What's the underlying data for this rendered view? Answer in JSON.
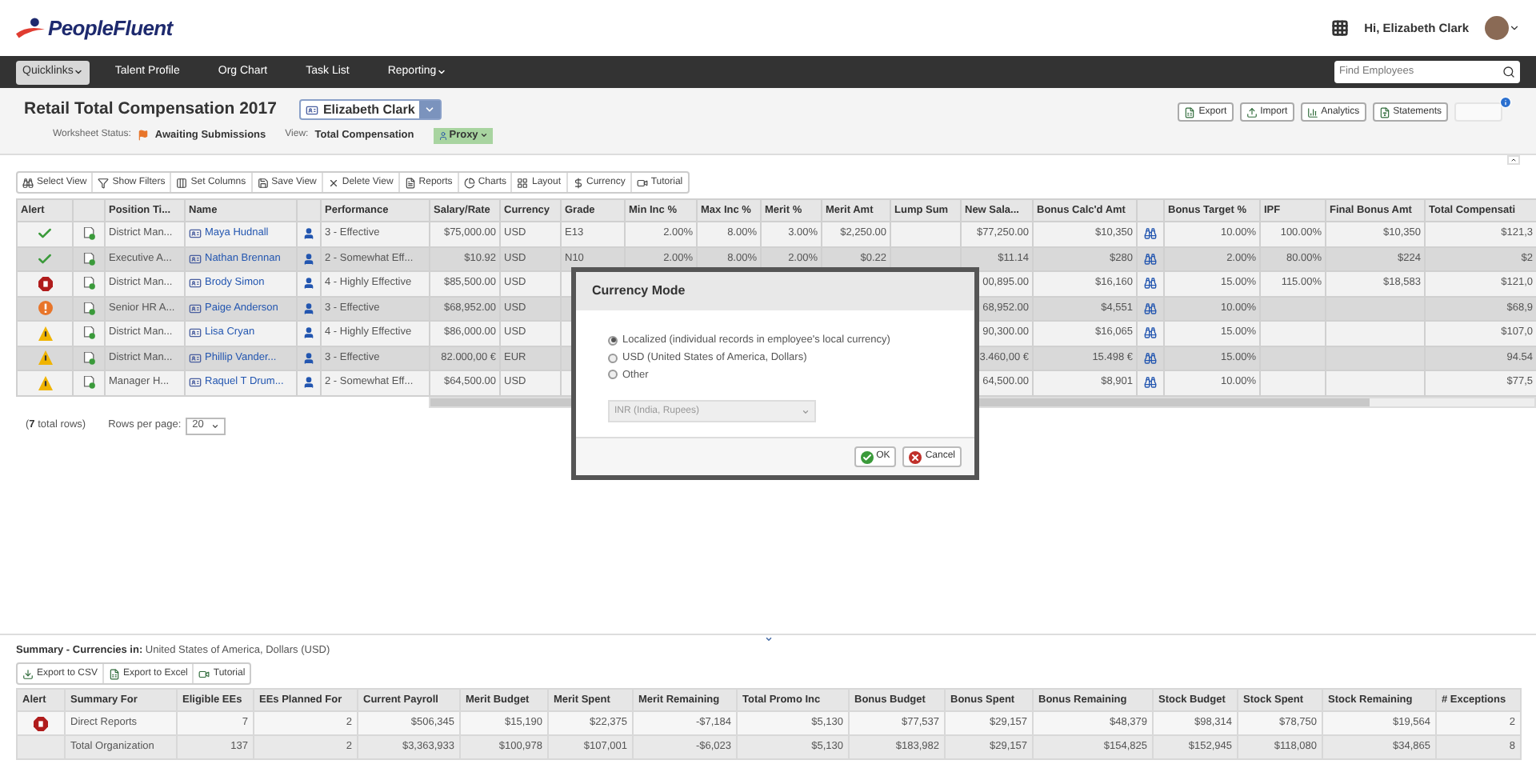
{
  "header": {
    "logo": "PeopleFluent",
    "greeting": "Hi, Elizabeth Clark"
  },
  "nav": {
    "items": [
      {
        "label": "Quicklinks",
        "kind": "button",
        "caret": true
      },
      {
        "label": "Talent Profile",
        "kind": "link",
        "caret": false
      },
      {
        "label": "Org Chart",
        "kind": "link",
        "caret": false
      },
      {
        "label": "Task List",
        "kind": "link",
        "caret": false
      },
      {
        "label": "Reporting",
        "kind": "link",
        "caret": true
      }
    ],
    "search": {
      "placeholder": "Find Employees"
    }
  },
  "worksheet": {
    "title": "Retail Total Compensation 2017",
    "employee": "Elizabeth Clark",
    "status_label": "Worksheet Status:",
    "status": "Awaiting Submissions",
    "view_label": "View:",
    "view": "Total Compensation",
    "proxy": "Proxy",
    "actions": [
      {
        "label": "Export",
        "disabled": false
      },
      {
        "label": "Import",
        "disabled": false
      },
      {
        "label": "Analytics",
        "disabled": false
      },
      {
        "label": "Statements",
        "disabled": false
      }
    ]
  },
  "toolbar": [
    "Select View",
    "Show Filters",
    "Set Columns",
    "Save View",
    "Delete View",
    "Reports",
    "Charts",
    "Layout",
    "Currency",
    "Tutorial"
  ],
  "table": {
    "columns": [
      {
        "kind": "text",
        "label": "Alert"
      },
      {
        "kind": "icon"
      },
      {
        "kind": "text",
        "label": "Position Ti..."
      },
      {
        "kind": "text",
        "label": "Name"
      },
      {
        "kind": "icon"
      },
      {
        "kind": "text",
        "label": "Performance"
      },
      {
        "kind": "text",
        "label": "Salary/Rate"
      },
      {
        "kind": "text",
        "label": "Currency"
      },
      {
        "kind": "text",
        "label": "Grade"
      },
      {
        "kind": "text",
        "label": "Min Inc %"
      },
      {
        "kind": "text",
        "label": "Max Inc %"
      },
      {
        "kind": "text",
        "label": "Merit %"
      },
      {
        "kind": "text",
        "label": "Merit Amt"
      },
      {
        "kind": "text",
        "label": "Lump Sum"
      },
      {
        "kind": "text",
        "label": "New Sala..."
      },
      {
        "kind": "text",
        "label": "Bonus Calc'd Amt"
      },
      {
        "kind": "icon"
      },
      {
        "kind": "text",
        "label": "Bonus Target %"
      },
      {
        "kind": "text",
        "label": "IPF"
      },
      {
        "kind": "text",
        "label": "Final Bonus Amt"
      },
      {
        "kind": "text",
        "label": "Total Compensati"
      }
    ],
    "rows": [
      {
        "alert": {
          "kind": "ok"
        },
        "position": "District Man...",
        "name": "Maya Hudnall",
        "performance": "3 - Effective",
        "salary": "$75,000.00",
        "currency": "USD",
        "grade": "E13",
        "min_inc": "2.00%",
        "max_inc": "8.00%",
        "merit_pct": "3.00%",
        "merit_amt": "$2,250.00",
        "new_salary": "$77,250.00",
        "bonus_calc": "$10,350",
        "bonus_target": "10.00%",
        "ipf": "100.00%",
        "final_bonus": "$10,350",
        "total_comp": "$121,3"
      },
      {
        "alert": {
          "kind": "ok"
        },
        "position": "Executive A...",
        "name": "Nathan Brennan",
        "performance": "2 - Somewhat Eff...",
        "salary": "$10.92",
        "currency": "USD",
        "grade": "N10",
        "min_inc": "2.00%",
        "max_inc": "8.00%",
        "merit_pct": "2.00%",
        "merit_amt": "$0.22",
        "new_salary": "$11.14",
        "bonus_calc": "$280",
        "bonus_target": "2.00%",
        "ipf": "80.00%",
        "final_bonus": "$224",
        "total_comp": "$2"
      },
      {
        "alert": {
          "kind": "stop"
        },
        "position": "District Man...",
        "name": "Brody Simon",
        "performance": "4 - Highly Effective",
        "salary": "$85,500.00",
        "currency": "USD",
        "new_salary": "00,895.00",
        "bonus_calc": "$16,160",
        "bonus_target": "15.00%",
        "ipf": "115.00%",
        "final_bonus": "$18,583",
        "total_comp": "$121,0"
      },
      {
        "alert": {
          "kind": "exclamation"
        },
        "position": "Senior HR A...",
        "name": "Paige Anderson",
        "performance": "3 - Effective",
        "salary": "$68,952.00",
        "currency": "USD",
        "new_salary": "68,952.00",
        "bonus_calc": "$4,551",
        "bonus_target": "10.00%",
        "total_comp": "$68,9"
      },
      {
        "alert": {
          "kind": "warning"
        },
        "position": "District Man...",
        "name": "Lisa Cryan",
        "performance": "4 - Highly Effective",
        "salary": "$86,000.00",
        "currency": "USD",
        "new_salary": "90,300.00",
        "bonus_calc": "$16,065",
        "bonus_target": "15.00%",
        "total_comp": "$107,0"
      },
      {
        "alert": {
          "kind": "warning"
        },
        "position": "District Man...",
        "name": "Phillip Vander...",
        "performance": "3 - Effective",
        "salary": "82.000,00 €",
        "currency": "EUR",
        "new_salary": "3.460,00 €",
        "bonus_calc": "15.498 €",
        "bonus_target": "15.00%",
        "total_comp": "94.54"
      },
      {
        "alert": {
          "kind": "warning"
        },
        "position": "Manager H...",
        "name": "Raquel T Drum...",
        "performance": "2 - Somewhat Eff...",
        "salary": "$64,500.00",
        "currency": "USD",
        "new_salary": "64,500.00",
        "bonus_calc": "$8,901",
        "bonus_target": "10.00%",
        "total_comp": "$77,5"
      }
    ]
  },
  "pager": {
    "total": "7",
    "total_suffix": "total rows)",
    "total_prefix": "(",
    "rows_per_page_label": "Rows per page:",
    "rows_per_page": "20"
  },
  "currency_modal": {
    "title": "Currency Mode",
    "options": [
      {
        "label": "Localized (individual records in employee's local currency)",
        "selected": true
      },
      {
        "label": "USD (United States of America, Dollars)",
        "selected": false
      },
      {
        "label": "Other",
        "selected": false
      }
    ],
    "select": {
      "value": "INR (India, Rupees)",
      "disabled": true
    },
    "buttons": [
      "OK",
      "Cancel"
    ]
  },
  "summary": {
    "title": "Summary - Currencies in:",
    "currency": "United States of America, Dollars (USD)",
    "toolbar": [
      "Export to CSV",
      "Export to Excel",
      "Tutorial"
    ],
    "columns": [
      "Alert",
      "Summary For",
      "Eligible EEs",
      "EEs Planned For",
      "Current Payroll",
      "Merit Budget",
      "Merit Spent",
      "Merit Remaining",
      "Total Promo Inc",
      "Bonus Budget",
      "Bonus Spent",
      "Bonus Remaining",
      "Stock Budget",
      "Stock Spent",
      "Stock Remaining",
      "# Exceptions"
    ],
    "rows": [
      {
        "alert": {
          "kind": "stop"
        },
        "values": [
          "Direct Reports",
          "7",
          "2",
          "$506,345",
          "$15,190",
          "$22,375",
          "-$7,184",
          "$5,130",
          "$77,537",
          "$29,157",
          "$48,379",
          "$98,314",
          "$78,750",
          "$19,564",
          "2"
        ]
      },
      {
        "values": [
          "Total Organization",
          "137",
          "2",
          "$3,363,933",
          "$100,978",
          "$107,001",
          "-$6,023",
          "$5,130",
          "$183,982",
          "$29,157",
          "$154,825",
          "$152,945",
          "$118,080",
          "$34,865",
          "8"
        ]
      }
    ]
  }
}
